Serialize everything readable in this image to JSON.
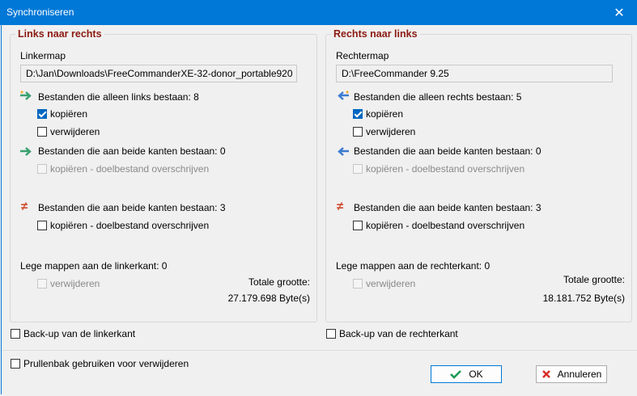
{
  "window": {
    "title": "Synchroniseren",
    "close_glyph": "✕"
  },
  "left": {
    "title": "Links naar rechts",
    "folder_label": "Linkermap",
    "folder_path": "D:\\Jan\\Downloads\\FreeCommanderXE-32-donor_portable920",
    "only_here": "Bestanden die alleen links bestaan: 8",
    "copy": "kopiëren",
    "delete": "verwijderen",
    "both_same": "Bestanden die aan beide kanten bestaan: 0",
    "copy_overwrite_disabled": "kopiëren - doelbestand overschrijven",
    "both_diff": "Bestanden die aan beide kanten bestaan: 3",
    "copy_overwrite": "kopiëren - doelbestand overschrijven",
    "empty_folders": "Lege mappen aan de linkerkant: 0",
    "empty_delete": "verwijderen",
    "total_label": "Totale grootte:",
    "total_value": "27.179.698 Byte(s)",
    "backup": "Back-up van de linkerkant"
  },
  "right": {
    "title": "Rechts naar links",
    "folder_label": "Rechtermap",
    "folder_path": "D:\\FreeCommander 9.25",
    "only_here": "Bestanden die alleen rechts bestaan: 5",
    "copy": "kopiëren",
    "delete": "verwijderen",
    "both_same": "Bestanden die aan beide kanten bestaan: 0",
    "copy_overwrite_disabled": "kopiëren - doelbestand overschrijven",
    "both_diff": "Bestanden die aan beide kanten bestaan: 3",
    "copy_overwrite": "kopiëren - doelbestand overschrijven",
    "empty_folders": "Lege mappen aan de rechterkant: 0",
    "empty_delete": "verwijderen",
    "total_label": "Totale grootte:",
    "total_value": "18.181.752 Byte(s)",
    "backup": "Back-up van de rechterkant"
  },
  "recycle_bin": "Prullenbak gebruiken voor verwijderen",
  "buttons": {
    "ok": "OK",
    "cancel": "Annuleren"
  },
  "colors": {
    "accent": "#0078d7",
    "legend": "#8b1a10",
    "arrow_green": "#3aa070",
    "arrow_blue": "#3b7bd0",
    "neq_red": "#d04a2c"
  }
}
